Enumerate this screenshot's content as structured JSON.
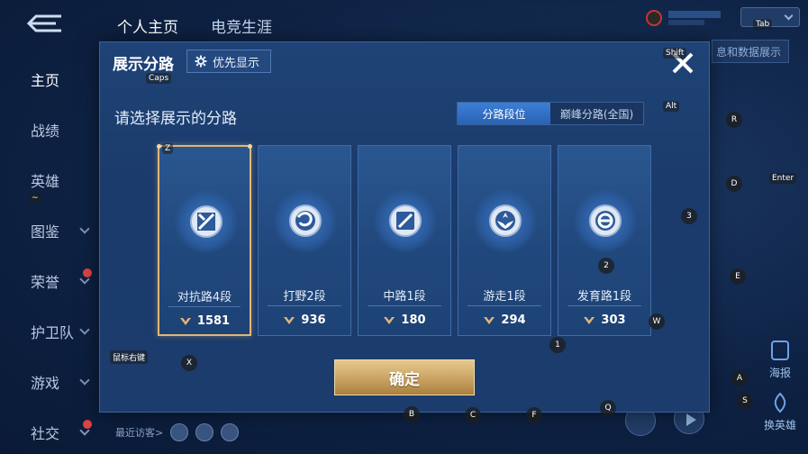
{
  "background": {
    "top_tabs": [
      "个人主页",
      "电竞生涯"
    ],
    "side_nav": [
      {
        "label": "主页",
        "active": true,
        "chevron": false,
        "badge": false
      },
      {
        "label": "战绩",
        "active": false,
        "chevron": false,
        "badge": false
      },
      {
        "label": "英雄",
        "active": false,
        "chevron": false,
        "badge": false
      },
      {
        "label": "图鉴",
        "active": false,
        "chevron": true,
        "badge": false
      },
      {
        "label": "荣誉",
        "active": false,
        "chevron": true,
        "badge": true
      },
      {
        "label": "护卫队",
        "active": false,
        "chevron": true,
        "badge": false
      },
      {
        "label": "游戏",
        "active": false,
        "chevron": true,
        "badge": false
      },
      {
        "label": "社交",
        "active": false,
        "chevron": true,
        "badge": true
      }
    ],
    "right_strip_label": "息和数据展示",
    "right_icons": [
      {
        "label": "海报"
      },
      {
        "label": "换英雄"
      }
    ],
    "bottom_visitor_label": "最近访客>"
  },
  "modal": {
    "title": "展示分路",
    "priority_button": "优先显示",
    "subtitle": "请选择展示的分路",
    "toggle": {
      "left": "分路段位",
      "right": "巅峰分路(全国)",
      "active": "left"
    },
    "cards": [
      {
        "name": "对抗路4段",
        "score": "1581",
        "icon": "clash-lane-icon",
        "selected": true
      },
      {
        "name": "打野2段",
        "score": "936",
        "icon": "jungle-icon",
        "selected": false
      },
      {
        "name": "中路1段",
        "score": "180",
        "icon": "mid-lane-icon",
        "selected": false
      },
      {
        "name": "游走1段",
        "score": "294",
        "icon": "roam-icon",
        "selected": false
      },
      {
        "name": "发育路1段",
        "score": "303",
        "icon": "farm-lane-icon",
        "selected": false
      }
    ],
    "confirm": "确定"
  },
  "key_hints": {
    "caps": "Caps",
    "shift": "Shift",
    "tab": "Tab",
    "alt": "Alt",
    "enter": "Enter",
    "z": "Z",
    "tilde": "~",
    "x": "X",
    "mouse_right": "鼠标右键",
    "b": "B",
    "c": "C",
    "f": "F",
    "q": "Q",
    "w": "W",
    "r": "R",
    "d": "D",
    "e": "E",
    "a": "A",
    "s": "S",
    "n1": "1",
    "n2": "2",
    "n3": "3"
  },
  "colors": {
    "accent_gold": "#e0b679",
    "toggle_blue": "#3c7fd6",
    "modal_bg": "#1d3e70"
  }
}
